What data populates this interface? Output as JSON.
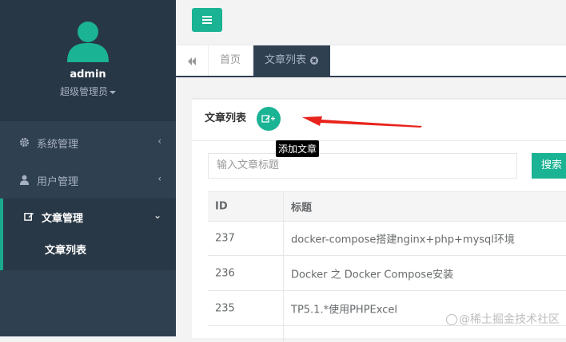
{
  "user": {
    "name": "admin",
    "role": "超级管理员"
  },
  "sidebar": {
    "items": [
      {
        "label": "系统管理",
        "icon": "gear-icon"
      },
      {
        "label": "用户管理",
        "icon": "user-icon"
      },
      {
        "label": "文章管理",
        "icon": "edit-icon",
        "children": [
          {
            "label": "文章列表"
          }
        ]
      }
    ]
  },
  "tabs": {
    "home": "首页",
    "active": "文章列表"
  },
  "panel": {
    "title": "文章列表",
    "add_tooltip": "添加文章",
    "search": {
      "placeholder": "输入文章标题",
      "button": "搜索"
    }
  },
  "table": {
    "columns": [
      "ID",
      "标题"
    ],
    "rows": [
      {
        "id": "237",
        "title": "docker-compose搭建nginx+php+mysql环境"
      },
      {
        "id": "236",
        "title": "Docker 之 Docker Compose安装"
      },
      {
        "id": "235",
        "title": "TP5.1.*使用PHPExcel"
      }
    ]
  },
  "watermark": "@稀土掘金技术社区",
  "colors": {
    "accent": "#1ab394",
    "sidebar_bg": "#2f4050",
    "profile_bg": "#283745",
    "arrow": "#e8231b"
  }
}
